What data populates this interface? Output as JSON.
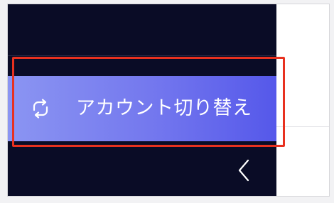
{
  "menu": {
    "switch_account": {
      "label": "アカウント切り替え",
      "icon": "switch-account-icon"
    }
  },
  "sidebar": {
    "collapse": {
      "icon": "chevron-left-icon"
    }
  },
  "colors": {
    "sidebar_bg": "#0a0c26",
    "item_gradient_start": "#8b95f2",
    "item_gradient_end": "#5558ea",
    "highlight": "#e8311f"
  }
}
